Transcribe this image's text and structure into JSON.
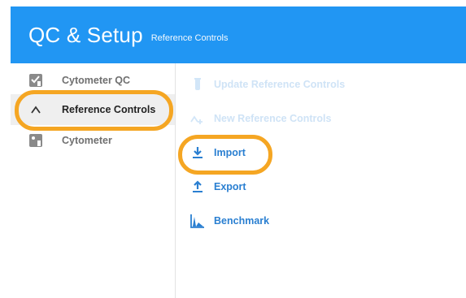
{
  "header": {
    "title": "QC & Setup",
    "subtitle": "Reference Controls"
  },
  "sidebar": {
    "items": [
      {
        "label": "Cytometer QC",
        "icon": "cytometer-qc-icon"
      },
      {
        "label": "Reference Controls",
        "icon": "reference-controls-icon",
        "active": true
      },
      {
        "label": "Cytometer",
        "icon": "cytometer-icon"
      }
    ]
  },
  "actions": {
    "update": {
      "label": "Update Reference Controls",
      "icon": "test-tube-icon",
      "enabled": false
    },
    "new": {
      "label": "New Reference Controls",
      "icon": "new-wave-icon",
      "enabled": false
    },
    "import": {
      "label": "Import",
      "icon": "download-icon",
      "enabled": true
    },
    "export": {
      "label": "Export",
      "icon": "upload-icon",
      "enabled": true
    },
    "benchmark": {
      "label": "Benchmark",
      "icon": "histogram-icon",
      "enabled": true
    }
  },
  "colors": {
    "header_bg": "#2196f3",
    "accent": "#2a7fd1",
    "highlight": "#f5a623"
  }
}
